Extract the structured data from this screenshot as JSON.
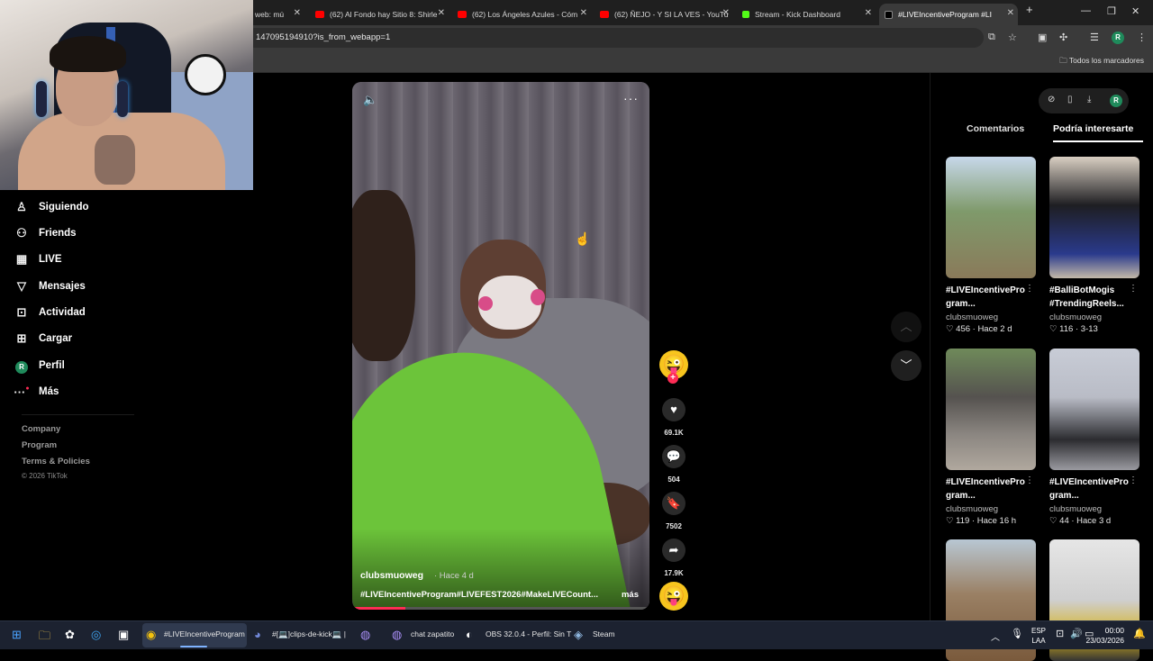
{
  "browser": {
    "tabs": [
      {
        "label": "web: mú",
        "favicon": "youtube"
      },
      {
        "label": "(62) Al Fondo hay Sitio 8: Shirle",
        "favicon": "youtube"
      },
      {
        "label": "(62) Los Ángeles Azules - Cóm",
        "favicon": "youtube"
      },
      {
        "label": "(62) ÑEJO - Y SI LA VES - YouTu",
        "favicon": "youtube"
      },
      {
        "label": "Stream - Kick Dashboard",
        "favicon": "kick"
      },
      {
        "label": "#LIVEIncentiveProgram #LI",
        "favicon": "tiktok",
        "active": true
      }
    ],
    "new_tab": "+",
    "url": "147095194910?is_from_webapp=1",
    "bookmarks_all": "Todos los marcadores",
    "profile_initial": "R"
  },
  "sidebar": {
    "items": [
      {
        "label": "Siguiendo",
        "icon": "person-follow-icon"
      },
      {
        "label": "Friends",
        "icon": "people-icon"
      },
      {
        "label": "LIVE",
        "icon": "live-icon"
      },
      {
        "label": "Mensajes",
        "icon": "send-icon"
      },
      {
        "label": "Actividad",
        "icon": "activity-icon"
      },
      {
        "label": "Cargar",
        "icon": "upload-icon"
      },
      {
        "label": "Perfil",
        "icon": "avatar"
      },
      {
        "label": "Más",
        "icon": "more-icon"
      }
    ],
    "profile_initial": "R",
    "footer": [
      "Company",
      "Program",
      "Terms & Policies"
    ],
    "copyright": "© 2026 TikTok"
  },
  "video": {
    "author": "clubsmuoweg",
    "posted": "· Hace 4 d",
    "caption": "#LIVEIncentiveProgram#LIVEFEST2026#MakeLIVECount...",
    "more": "más",
    "progress": 0.18
  },
  "actions": {
    "likes": "69.1K",
    "comments": "504",
    "saves": "7502",
    "shares": "17.9K"
  },
  "panel": {
    "tabs": [
      "Comentarios",
      "Podría interesarte"
    ],
    "cards": [
      {
        "title": "#LIVEIncentivePro gram...",
        "author": "clubsmuoweg",
        "meta": "♡ 456 · Hace 2 d"
      },
      {
        "title": "#BalliBotMogis #TrendingReels...",
        "author": "clubsmuoweg",
        "meta": "♡ 116 · 3-13"
      },
      {
        "title": "#LIVEIncentivePro gram...",
        "author": "clubsmuoweg",
        "meta": "♡ 119 · Hace 16 h"
      },
      {
        "title": "#LIVEIncentivePro gram...",
        "author": "clubsmuoweg",
        "meta": "♡ 44 · Hace 3 d"
      },
      {
        "title": "",
        "author": "",
        "meta": ""
      },
      {
        "title": "",
        "author": "",
        "meta": ""
      }
    ]
  },
  "taskbar": {
    "apps": [
      {
        "label": "#LIVEIncentiveProgram",
        "icon": "chrome-icon"
      },
      {
        "label": "#[💻]clips-de-kick💻 |",
        "icon": "discord-icon"
      },
      {
        "label": "chat zapatito",
        "icon": "app-icon"
      },
      {
        "label": "OBS 32.0.4 - Perfil: Sin T",
        "icon": "obs-icon"
      },
      {
        "label": "Steam",
        "icon": "steam-icon"
      }
    ],
    "lang_top": "ESP",
    "lang_bottom": "LAA",
    "time": "00:00",
    "date": "23/03/2026"
  }
}
